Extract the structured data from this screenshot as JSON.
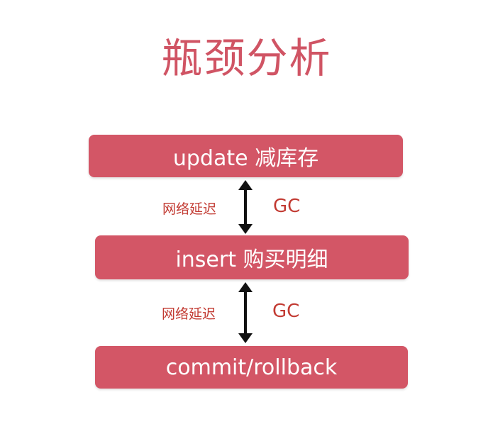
{
  "title": "瓶颈分析",
  "steps": [
    {
      "label": "update 减库存"
    },
    {
      "label": "insert 购买明细"
    },
    {
      "label": "commit/rollback"
    }
  ],
  "connectors": [
    {
      "latency_label": "网络延迟",
      "gc_label": "GC"
    },
    {
      "latency_label": "网络延迟",
      "gc_label": "GC"
    }
  ],
  "colors": {
    "title": "#d05464",
    "box_fill": "#d35666",
    "box_text": "#ffffff",
    "annotation": "#c23a32",
    "arrow": "#111111"
  }
}
